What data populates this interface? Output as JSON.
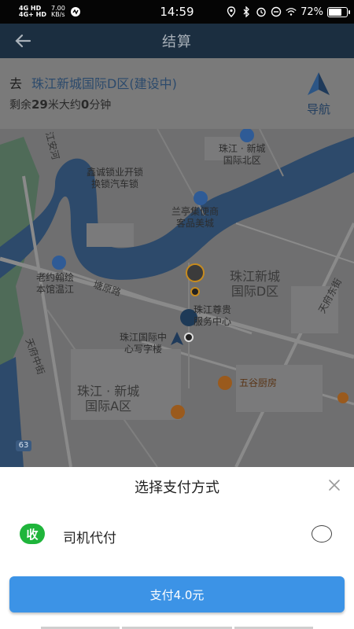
{
  "status_bar": {
    "net1": "4G HD",
    "net2": "4G+ HD",
    "speed": "7.00",
    "speed_unit": "KB/s",
    "time": "14:59",
    "battery": "72%",
    "battery_level": 0.72
  },
  "header": {
    "title": "结算"
  },
  "destination": {
    "go_label": "去",
    "place": "珠江新城国际D区(建设中)",
    "remain_prefix": "剩余",
    "distance": "29",
    "distance_suffix": "米大约",
    "minutes": "0",
    "minutes_suffix": "分钟",
    "nav_label": "导航"
  },
  "map": {
    "labels": {
      "north_area": "珠江 · 新城\n国际北区",
      "lock_shop": "鑫诚锁业开锁\n换锁汽车锁",
      "store": "兰亭集便商\n客品美城",
      "d_area": "珠江新城\n国际D区",
      "road_tangyuan": "塘原路",
      "service": "珠江尊贵\n服务中心",
      "school": "珠江国际中\n心写字楼",
      "old_zone": "老约翰绘\n本馆温江",
      "a_area": "珠江 · 新城\n国际A区",
      "restaurant": "五谷厨房",
      "road_tianfu": "天府东街",
      "road_tianfu_w": "天府中街",
      "river": "江安河",
      "badge": "63"
    }
  },
  "payment": {
    "title": "选择支付方式",
    "option_icon_text": "收",
    "option_label": "司机代付",
    "pay_button": "支付4.0元"
  },
  "colors": {
    "accent": "#3c93e6",
    "shou_green": "#1fb53b"
  }
}
